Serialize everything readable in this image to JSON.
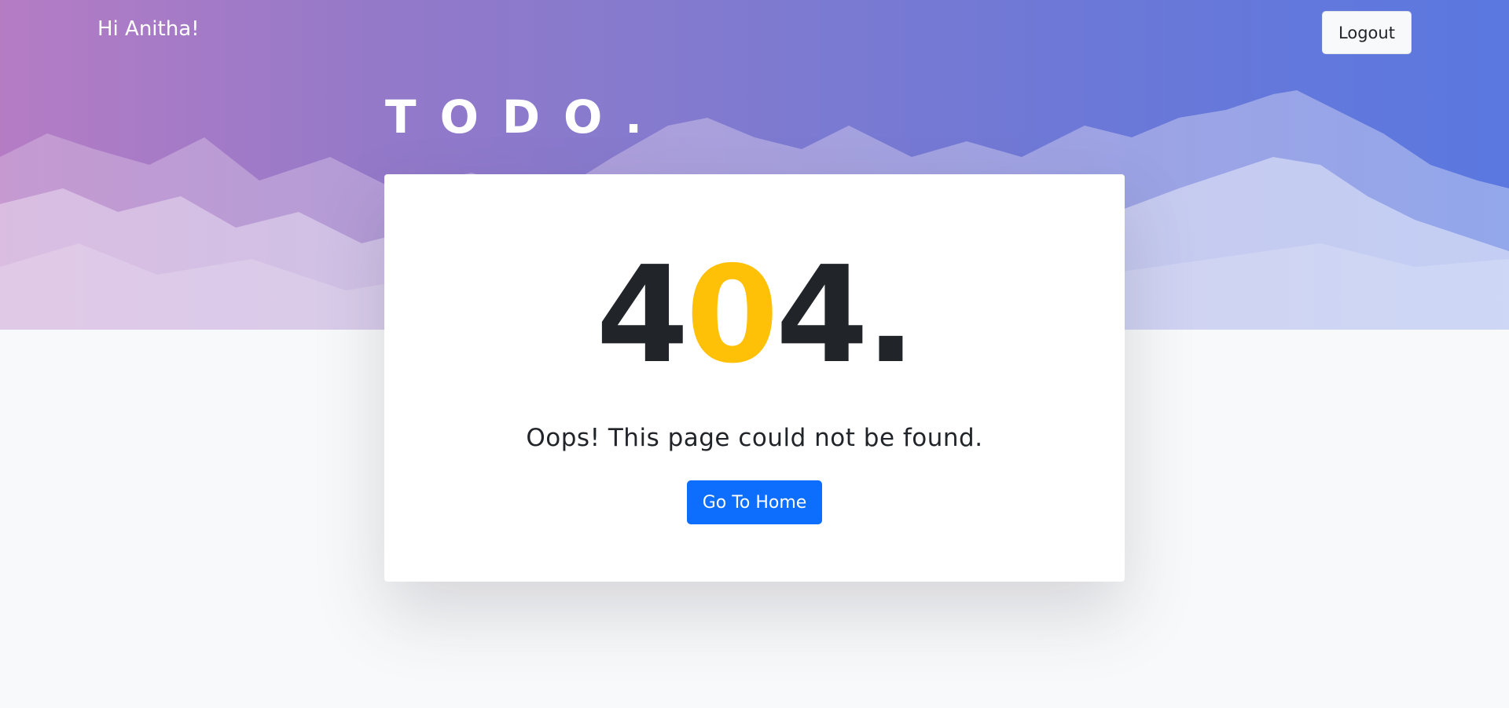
{
  "header": {
    "greeting": "Hi Anitha!",
    "logout_label": "Logout",
    "brand": "TODO."
  },
  "error": {
    "code_first": "4",
    "code_middle": "0",
    "code_last": "4",
    "code_dot": ".",
    "message": "Oops! This page could not be found.",
    "home_label": "Go To Home"
  },
  "colors": {
    "accent": "#ffc107",
    "primary_button": "#0d6efd",
    "text_dark": "#212529"
  }
}
